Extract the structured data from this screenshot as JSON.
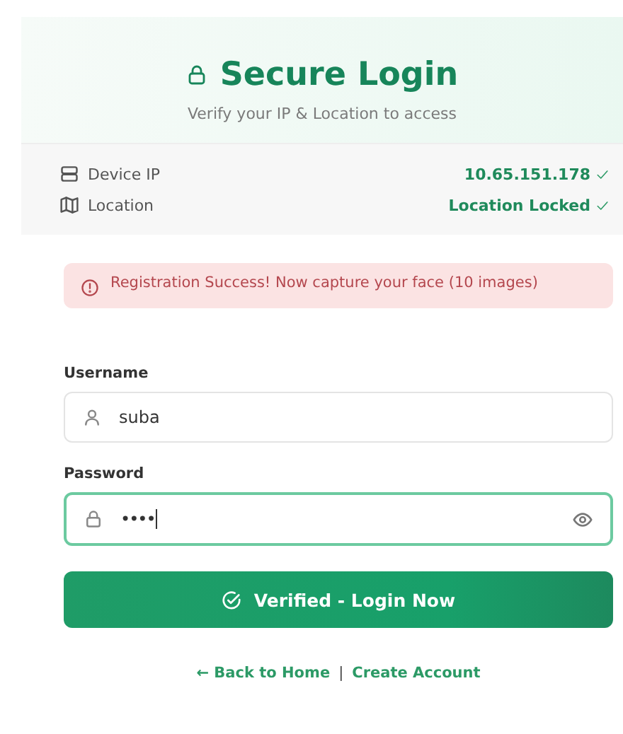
{
  "header": {
    "title": "Secure Login",
    "subtitle": "Verify your IP & Location to access"
  },
  "checks": [
    {
      "kind": "ip",
      "label": "Device IP",
      "value": "10.65.151.178",
      "verified": true
    },
    {
      "kind": "location",
      "label": "Location",
      "value": "Location Locked",
      "verified": true
    }
  ],
  "alert": {
    "text": "Registration Success! Now capture your face (10 images)"
  },
  "fields": [
    {
      "kind": "user",
      "label": "Username",
      "value": "suba",
      "focused": false
    },
    {
      "kind": "password",
      "label": "Password",
      "value": "••••",
      "focused": true
    }
  ],
  "submit": {
    "label": "Verified - Login Now"
  },
  "links": [
    {
      "label": "← Back to Home"
    },
    {
      "label": "Create Account"
    }
  ],
  "link_separator": "|"
}
